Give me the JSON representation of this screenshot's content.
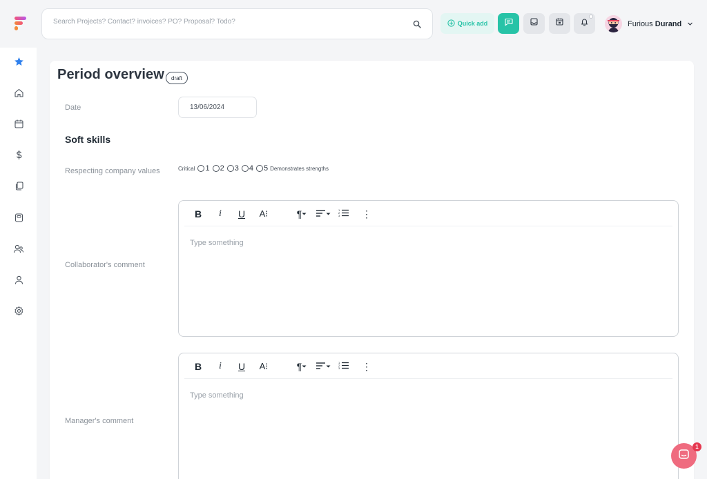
{
  "search": {
    "placeholder": "Search Projects? Contact? invoices? PO? Proposal? Todo?"
  },
  "header": {
    "quick_add_label": "Quick add",
    "user_first_name": "Furious",
    "user_last_name": "Durand",
    "buttons": [
      "chat-icon",
      "inbox-icon",
      "calendar-icon",
      "bell-icon"
    ]
  },
  "sidebar": {
    "items": [
      "star-icon",
      "home-icon",
      "calendar-icon",
      "dollar-icon",
      "documents-icon",
      "receipt-icon",
      "users-icon",
      "user-icon",
      "gear-icon"
    ]
  },
  "page": {
    "title": "Period overview",
    "status_badge": "draft"
  },
  "form": {
    "date_label": "Date",
    "date_value": "13/06/2024",
    "section_title": "Soft skills",
    "rating_label": "Respecting company values",
    "rating_low_label": "Critical",
    "rating_high_label": "Demonstrates strengths",
    "rating_options": [
      "1",
      "2",
      "3",
      "4",
      "5"
    ],
    "collaborator_label": "Collaborator's comment",
    "manager_label": "Manager's comment",
    "editor_placeholder": "Type something"
  },
  "toolbar": {
    "bold": "B",
    "italic": "i",
    "underline": "U",
    "font_size": "A⁝",
    "paragraph": "¶",
    "more": "⋮"
  },
  "chat": {
    "unread_count": "1"
  },
  "colors": {
    "accent": "#27c3a7",
    "chat": "#ef6b7f",
    "badge": "#e5384f"
  }
}
